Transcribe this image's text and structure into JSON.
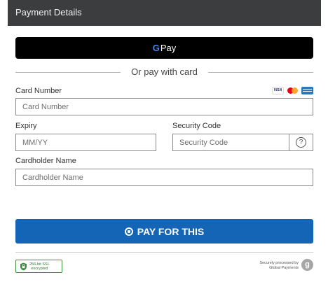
{
  "header": {
    "title": "Payment Details"
  },
  "gpay": {
    "g": "G",
    "pay": "Pay"
  },
  "divider": {
    "text": "Or pay with card"
  },
  "card_number": {
    "label": "Card Number",
    "placeholder": "Card Number",
    "value": ""
  },
  "card_brands": [
    "VISA",
    "mastercard",
    "amex"
  ],
  "expiry": {
    "label": "Expiry",
    "placeholder": "MM/YY",
    "value": ""
  },
  "security": {
    "label": "Security Code",
    "placeholder": "Security Code",
    "value": "",
    "help_icon": "?"
  },
  "holder": {
    "label": "Cardholder Name",
    "placeholder": "Cardholder Name",
    "value": ""
  },
  "pay_button": {
    "label": "PAY FOR THIS"
  },
  "ssl_badge": {
    "line1": "256-bit SSL",
    "line2": "encrypted"
  },
  "footer": {
    "line1": "Securely processed by",
    "line2": "Global Payments",
    "logo": "g"
  },
  "colors": {
    "header_bg": "#3c3d3f",
    "pay_button": "#1565b6",
    "gpay_bg": "#000000",
    "ssl_green": "#3b8d3b"
  }
}
